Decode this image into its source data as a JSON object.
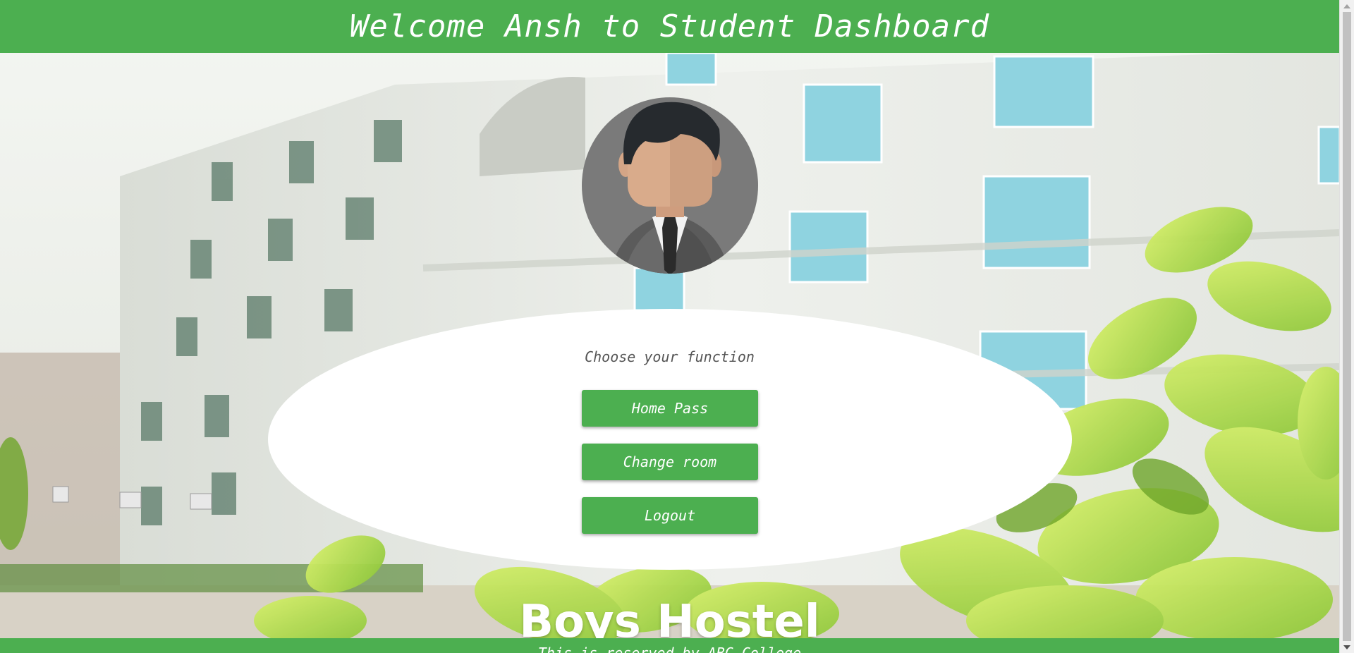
{
  "header": {
    "title": "Welcome Ansh to Student Dashboard"
  },
  "avatar": {
    "icon": "student-avatar-icon"
  },
  "panel": {
    "title": "Choose your function",
    "buttons": [
      {
        "label": "Home Pass"
      },
      {
        "label": "Change room"
      },
      {
        "label": "Logout"
      }
    ]
  },
  "background": {
    "banner": "Boys Hostel"
  },
  "footer": {
    "text": "This is reserved by ABC College"
  },
  "colors": {
    "accent": "#4caf50",
    "panel": "#ffffff",
    "muted_text": "#555555"
  }
}
